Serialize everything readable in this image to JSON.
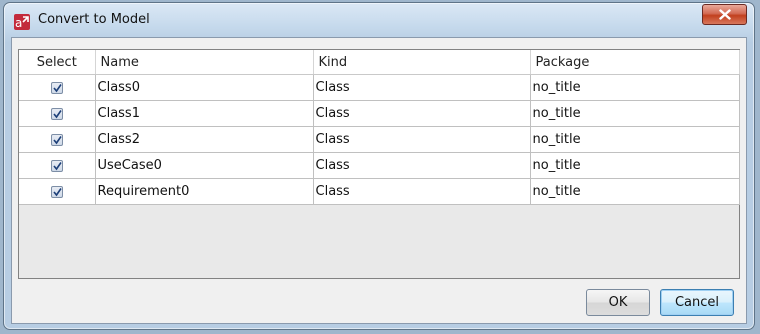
{
  "window": {
    "title": "Convert to Model"
  },
  "table": {
    "columns": [
      "Select",
      "Name",
      "Kind",
      "Package"
    ],
    "rows": [
      {
        "selected": true,
        "name": "Class0",
        "kind": "Class",
        "package": "no_title"
      },
      {
        "selected": true,
        "name": "Class1",
        "kind": "Class",
        "package": "no_title"
      },
      {
        "selected": true,
        "name": "Class2",
        "kind": "Class",
        "package": "no_title"
      },
      {
        "selected": true,
        "name": "UseCase0",
        "kind": "Class",
        "package": "no_title"
      },
      {
        "selected": true,
        "name": "Requirement0",
        "kind": "Class",
        "package": "no_title"
      }
    ]
  },
  "buttons": {
    "ok": "OK",
    "cancel": "Cancel"
  },
  "icons": {
    "app": "astah-app-icon",
    "close": "close-icon",
    "checkbox": "checkbox-checked-icon"
  }
}
